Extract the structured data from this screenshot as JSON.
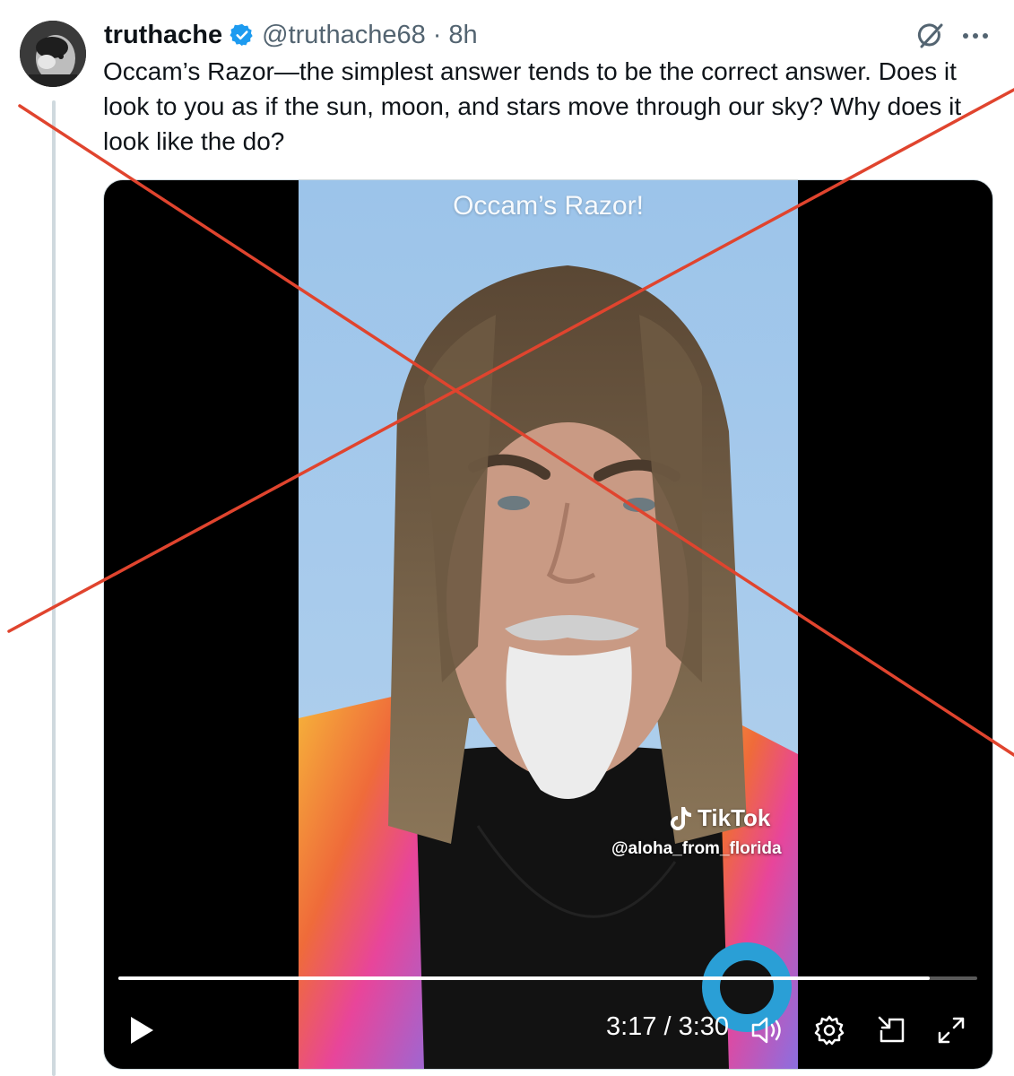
{
  "tweet": {
    "display_name": "truthache",
    "verified": true,
    "handle": "@truthache68",
    "separator": "·",
    "time": "8h",
    "text": "Occam’s Razor—the simplest answer tends to be the correct answer. Does it look to you as if the sun, moon, and stars move through our sky? Why does it look like the do?",
    "grok_icon": "grok-icon",
    "more_icon": "more-icon"
  },
  "video": {
    "overlay_title": "Occam’s Razor!",
    "tiktok_brand": "TikTok",
    "tiktok_user": "@aloha_from_florida",
    "time_display": "3:17 / 3:30",
    "progress": 0.945,
    "icons": [
      "play-icon",
      "volume-icon",
      "settings-icon",
      "pip-icon",
      "fullscreen-icon"
    ]
  },
  "colors": {
    "verified_blue": "#1d9bf0",
    "cross_red": "#e0442e",
    "secondary_text": "#536471"
  }
}
